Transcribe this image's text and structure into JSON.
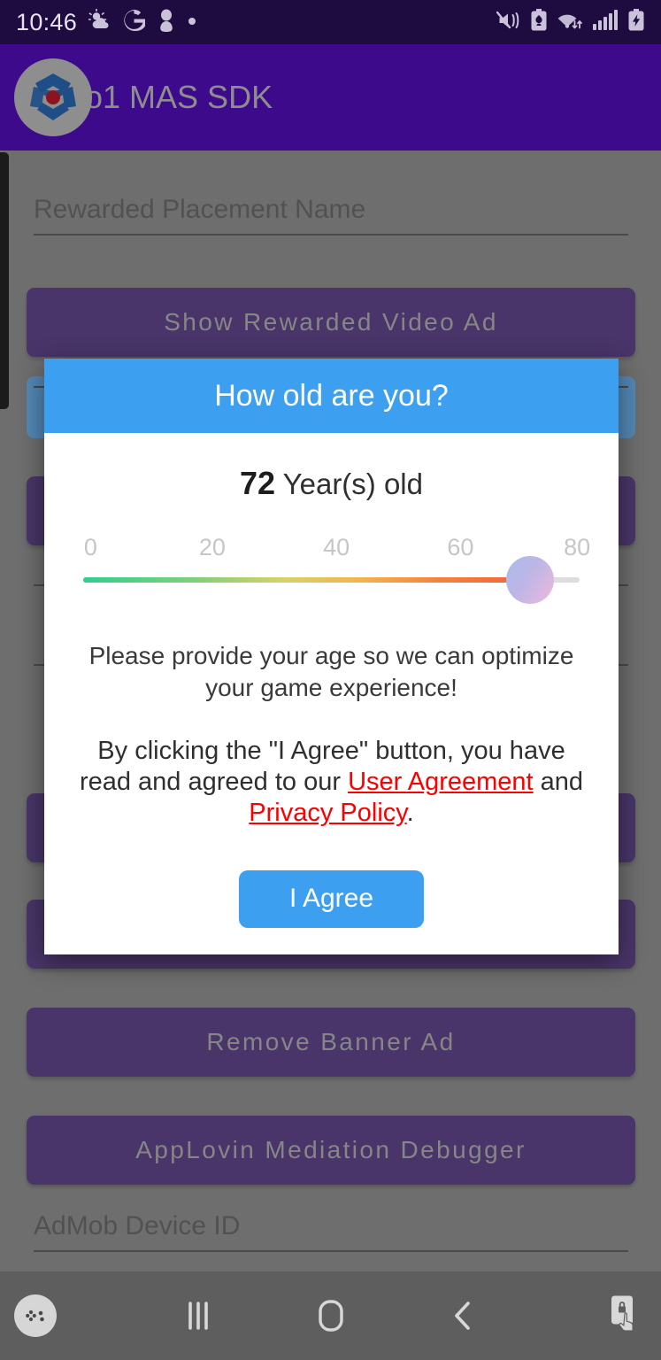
{
  "status_bar": {
    "time": "10:46",
    "left_icons": [
      "weather-partly-cloudy-icon",
      "google-g-icon",
      "contact-avatar-icon",
      "dot-indicator-icon"
    ],
    "right_icons": [
      "vibrate-mute-icon",
      "battery-saver-icon",
      "wifi-transfer-icon",
      "cellular-signal-icon",
      "battery-charging-icon"
    ],
    "background_color": "#1e0b3f"
  },
  "app_bar": {
    "title": "o1 MAS SDK",
    "logo_icon": "o1-app-logo-icon",
    "background_color": "#3d0a8c",
    "title_color": "#8d8d8d"
  },
  "background_app": {
    "fields": [
      {
        "placeholder": "Rewarded Placement Name",
        "value": ""
      },
      {
        "placeholder": "AdMob Device ID",
        "value": ""
      }
    ],
    "buttons": [
      {
        "label": "Show Rewarded Video Ad"
      },
      {
        "label": "Remove Banner Ad"
      },
      {
        "label": "AppLovin Mediation Debugger"
      }
    ],
    "button_color": "#2b0766",
    "accent_blue": "#3d9ff0"
  },
  "dialog": {
    "title": "How old are you?",
    "header_color": "#3d9ff0",
    "age_value": "72",
    "age_unit": "Year(s) old",
    "description": "Please provide your age so we can optimize your game experience!",
    "consent": {
      "part1": "By clicking the \"I Agree\" button, you have read and agreed to our ",
      "link1": "User Agreement",
      "part2": " and ",
      "link2": "Privacy Policy",
      "part3": "."
    },
    "link_color": "#fa0000",
    "agree_label": "I Agree",
    "slider": {
      "min": 0,
      "max": 80,
      "value": 72,
      "ticks": [
        "0",
        "20",
        "40",
        "60",
        "80"
      ],
      "tick_values": [
        0,
        20,
        40,
        60,
        80
      ],
      "track_gradient_start": "#2ecf8d",
      "track_gradient_end": "#f0623a",
      "thumb_gradient_start": "#a9bcea",
      "thumb_gradient_end": "#efb8de"
    }
  },
  "nav_bar": {
    "background_color": "#5e5e5e",
    "items": [
      {
        "icon": "game-booster-icon",
        "label": ""
      },
      {
        "icon": "recent-apps-icon",
        "label": ""
      },
      {
        "icon": "home-icon",
        "label": ""
      },
      {
        "icon": "back-icon",
        "label": ""
      },
      {
        "icon": "screen-lock-touch-icon",
        "label": ""
      }
    ]
  }
}
